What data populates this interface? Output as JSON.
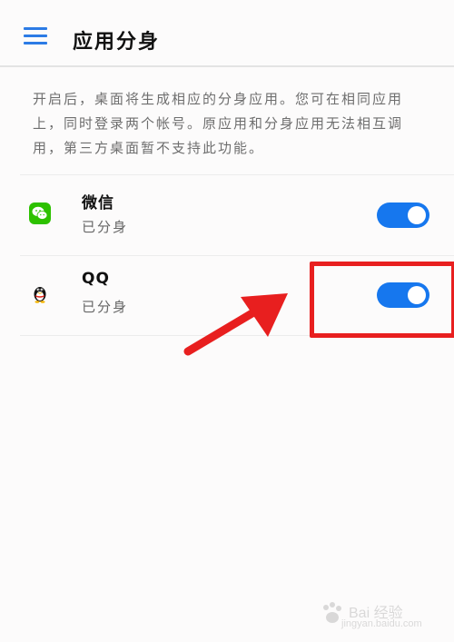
{
  "header": {
    "title": "应用分身"
  },
  "description": "开启后，桌面将生成相应的分身应用。您可在相同应用上，同时登录两个帐号。原应用和分身应用无法相互调用，第三方桌面暂不支持此功能。",
  "apps": [
    {
      "name": "微信",
      "status": "已分身",
      "icon": "wechat-icon",
      "toggle_on": true
    },
    {
      "name": "QQ",
      "status": "已分身",
      "icon": "qq-penguin-icon",
      "toggle_on": true
    }
  ],
  "annotation": {
    "highlight_color": "#e81f1f",
    "target": "QQ toggle"
  },
  "watermark": {
    "line1": "Bai 经验",
    "line2": "jingyan.baidu.com"
  },
  "colors": {
    "accent": "#1677ee",
    "menu_icon": "#2c7be5",
    "wechat_green": "#2dc100"
  }
}
